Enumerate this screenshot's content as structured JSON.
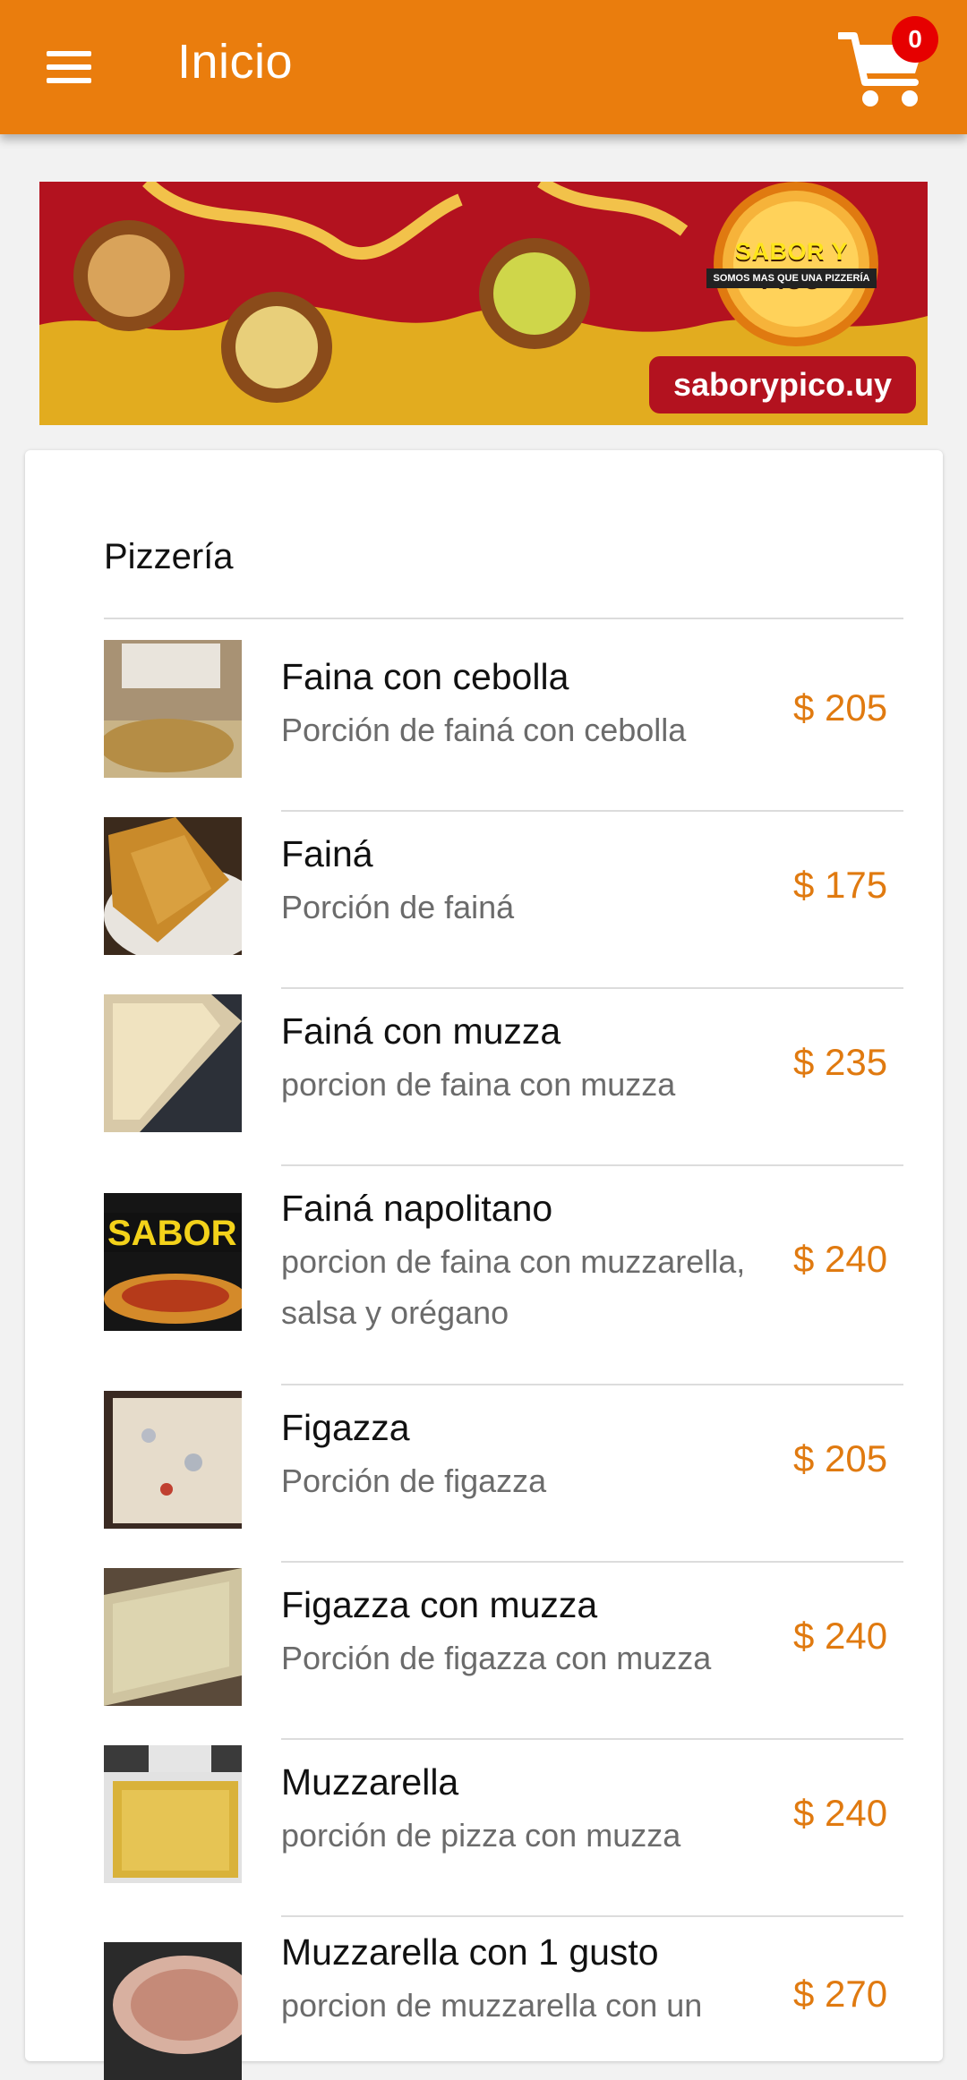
{
  "appbar": {
    "title": "Inicio",
    "menu_icon": "hamburger-menu-icon",
    "cart_icon": "shopping-cart-icon",
    "cart_count": "0",
    "color": "#ea7d0d"
  },
  "banner": {
    "logo_title": "SABOR Y PICO",
    "logo_subtitle": "SOMOS MAS QUE UNA PIZZERÍA",
    "url": "saborypico.uy"
  },
  "section": {
    "title": "Pizzería"
  },
  "items": [
    {
      "name": "Faina con cebolla",
      "desc": "Porción de fainá con cebolla",
      "price": "$ 205"
    },
    {
      "name": "Fainá",
      "desc": "Porción de fainá",
      "price": "$ 175"
    },
    {
      "name": "Fainá con muzza",
      "desc": "porcion de faina con muzza",
      "price": "$ 235"
    },
    {
      "name": "Fainá napolitano",
      "desc": "porcion de faina con muzzarella, salsa y orégano",
      "price": "$ 240"
    },
    {
      "name": "Figazza",
      "desc": "Porción de figazza",
      "price": "$ 205"
    },
    {
      "name": "Figazza con muzza",
      "desc": "Porción de figazza con muzza",
      "price": "$ 240"
    },
    {
      "name": "Muzzarella",
      "desc": "porción de pizza con muzza",
      "price": "$ 240"
    },
    {
      "name": "Muzzarella con 1 gusto",
      "desc": "porcion de muzzarella con un",
      "price": "$ 270"
    }
  ],
  "colors": {
    "accent": "#ea7d0d",
    "price": "#e07a10",
    "badge": "#e60000"
  }
}
